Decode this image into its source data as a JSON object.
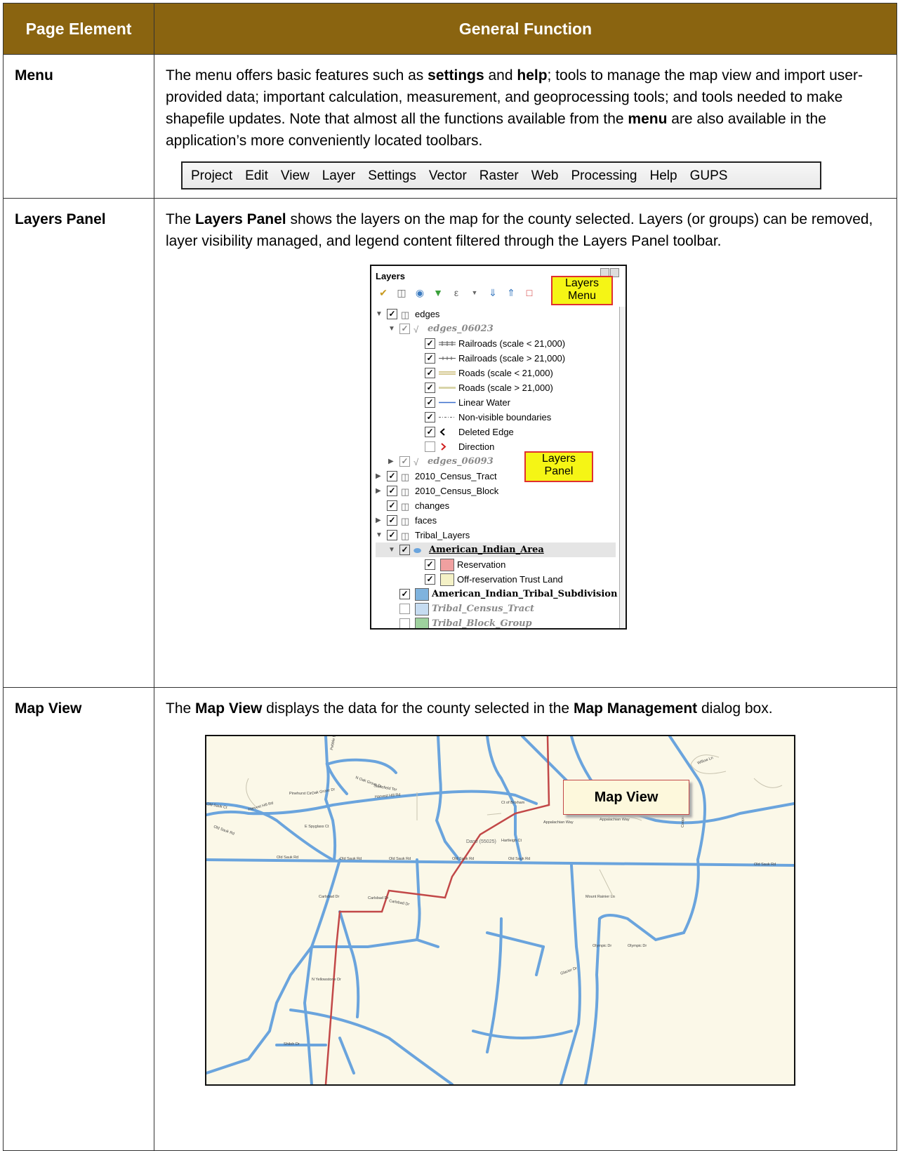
{
  "table": {
    "headers": [
      "Page Element",
      "General Function"
    ],
    "rows": [
      {
        "name": "Menu",
        "desc": [
          {
            "t": "The menu offers basic features such as "
          },
          {
            "t": "settings",
            "b": true
          },
          {
            "t": " and "
          },
          {
            "t": "help",
            "b": true
          },
          {
            "t": "; tools to manage the map view and import user-provided data; important calculation, measurement, and geoprocessing tools; and tools needed to make shapefile updates. Note that almost all the functions available from the "
          },
          {
            "t": "menu",
            "b": true
          },
          {
            "t": " are also available in the application’s more conveniently located toolbars."
          }
        ]
      },
      {
        "name": "Layers Panel",
        "desc": [
          {
            "t": "The "
          },
          {
            "t": "Layers Panel",
            "b": true
          },
          {
            "t": " shows the layers on the map for the county selected. Layers (or groups) can be removed, layer visibility managed, and legend content filtered through the Layers Panel toolbar."
          }
        ]
      },
      {
        "name": "Map View",
        "desc": [
          {
            "t": "The "
          },
          {
            "t": "Map View",
            "b": true
          },
          {
            "t": " displays the data for the county selected in the "
          },
          {
            "t": "Map Management",
            "b": true
          },
          {
            "t": " dialog box."
          }
        ]
      }
    ]
  },
  "menubar": {
    "items": [
      "Project",
      "Edit",
      "View",
      "Layer",
      "Settings",
      "Vector",
      "Raster",
      "Web",
      "Processing",
      "Help",
      "GUPS"
    ]
  },
  "layers_panel": {
    "title": "Layers",
    "callout_menu": [
      "Layers",
      "Menu"
    ],
    "callout_panel": [
      "Layers",
      "Panel"
    ],
    "items": [
      {
        "label": "edges",
        "indent": 0,
        "twisty": "open",
        "checked": true,
        "icon": "group"
      },
      {
        "label": "edges_06023",
        "indent": 1,
        "twisty": "open",
        "checked": "dim",
        "icon": "line",
        "style": "italic-grey"
      },
      {
        "label": "Railroads (scale < 21,000)",
        "indent": 3,
        "checked": true,
        "sym": "rail-a"
      },
      {
        "label": "Railroads (scale > 21,000)",
        "indent": 3,
        "checked": true,
        "sym": "rail-b"
      },
      {
        "label": "Roads (scale < 21,000)",
        "indent": 3,
        "checked": true,
        "sym": "road-a"
      },
      {
        "label": "Roads (scale > 21,000)",
        "indent": 3,
        "checked": true,
        "sym": "road-b"
      },
      {
        "label": "Linear Water",
        "indent": 3,
        "checked": true,
        "sym": "water"
      },
      {
        "label": "Non-visible boundaries",
        "indent": 3,
        "checked": true,
        "sym": "nonvis"
      },
      {
        "label": "Deleted Edge",
        "indent": 3,
        "checked": true,
        "sym": "deleted"
      },
      {
        "label": "Direction",
        "indent": 3,
        "checked": false,
        "sym": "direction"
      },
      {
        "label": "edges_06093",
        "indent": 1,
        "twisty": "closed",
        "checked": "dim",
        "icon": "line",
        "style": "italic-grey"
      },
      {
        "label": "2010_Census_Tract",
        "indent": 0,
        "twisty": "closed",
        "checked": true,
        "icon": "group"
      },
      {
        "label": "2010_Census_Block",
        "indent": 0,
        "twisty": "closed",
        "checked": true,
        "icon": "group"
      },
      {
        "label": "changes",
        "indent": 0,
        "checked": true,
        "icon": "group"
      },
      {
        "label": "faces",
        "indent": 0,
        "twisty": "closed",
        "checked": true,
        "icon": "group"
      },
      {
        "label": "Tribal_Layers",
        "indent": 0,
        "twisty": "open",
        "checked": true,
        "icon": "group"
      },
      {
        "label": "American_Indian_Area",
        "indent": 1,
        "twisty": "open",
        "checked": true,
        "icon": "poly",
        "style": "selected"
      },
      {
        "label": "Reservation",
        "indent": 3,
        "checked": true,
        "swatch": "#f0a0a0"
      },
      {
        "label": "Off-reservation Trust Land",
        "indent": 3,
        "checked": true,
        "swatch": "#f4f1c6"
      },
      {
        "label": "American_Indian_Tribal_Subdivision",
        "indent": 1,
        "checked": true,
        "swatch": "#7fb3de",
        "style": "bold-serif"
      },
      {
        "label": "Tribal_Census_Tract",
        "indent": 1,
        "checked": false,
        "swatch": "#c6dcf1",
        "style": "italic-grey"
      },
      {
        "label": "Tribal_Block_Group",
        "indent": 1,
        "checked": false,
        "swatch": "#9ed19e",
        "style": "italic-grey"
      }
    ]
  },
  "map_view": {
    "label": "Map View",
    "county_label": "Dane (55025)",
    "street_labels": [
      "Pebble Beach Dr",
      "N Oak Grove Dr",
      "Stonefield Ter",
      "Pinehurst Cir",
      "Oak Grove Dr",
      "Harvest Hill Rd",
      "Harvest Hill Rd",
      "Old Sauk Ct",
      "Old Sauk Rd",
      "E Spyglass Ct",
      "Old Sauk Rd",
      "Old Sauk Rd",
      "Old Sauk Rd",
      "Old Sauk Rd",
      "Old Sauk Rd",
      "Carlsbad Dr",
      "Carlsbad Dr",
      "Carlsbad Dr",
      "N Yellowstone Dr",
      "Shiloh Dr",
      "Appalachian Way",
      "Appalachian Way",
      "Ct of Brixham",
      "Larch Cir",
      "S Highlands Ave",
      "Mount Rainier Ln",
      "Olympic Dr",
      "Olympic Dr",
      "Glacier Dr",
      "Cooper Ln",
      "Hartleigh Ct",
      "Willow Ln",
      "Old Sauk Rd"
    ]
  },
  "colors": {
    "header_bg": "#8a6410",
    "road": "#6aa4dd",
    "boundary": "#c24848",
    "map_bg": "#fbf8e8",
    "callout_fill": "#f5f515",
    "callout_border": "#e03030"
  }
}
